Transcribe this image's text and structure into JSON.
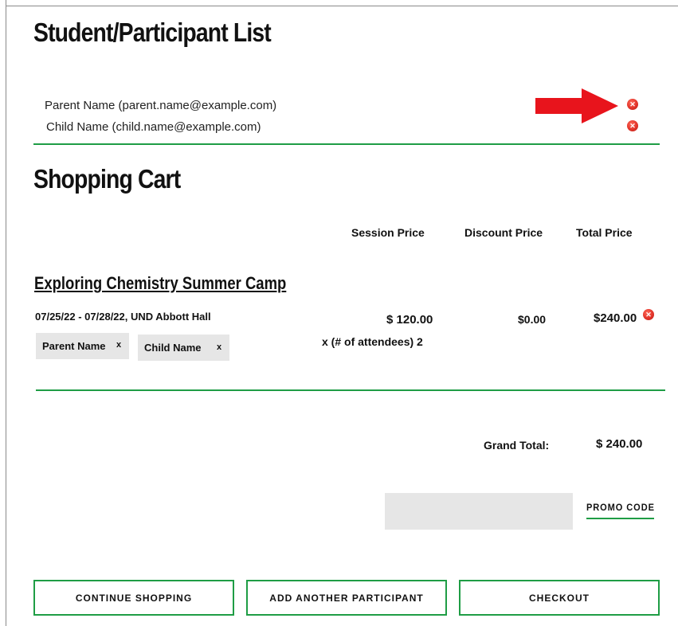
{
  "participants_section": {
    "title": "Student/Participant List",
    "participants": [
      {
        "label": "Parent Name (parent.name@example.com)"
      },
      {
        "label": "Child Name (child.name@example.com)"
      }
    ],
    "remove_icon": "remove-circle-icon",
    "annotation": "red-arrow-icon"
  },
  "cart": {
    "title": "Shopping Cart",
    "columns": {
      "session_price": "Session Price",
      "discount_price": "Discount Price",
      "total_price": "Total Price"
    },
    "items": [
      {
        "title": "Exploring Chemistry Summer Camp",
        "details": "07/25/22 - 07/28/22, UND Abbott Hall",
        "attendee_chips": [
          {
            "name": "Parent Name",
            "remove": "x"
          },
          {
            "name": "Child Name",
            "remove": "x"
          }
        ],
        "session_price": "$ 120.00",
        "attendees": "x  (# of attendees) 2",
        "discount_price": "$0.00",
        "total_price": "$240.00"
      }
    ],
    "grand_total_label": "Grand Total:",
    "grand_total_value": "$ 240.00",
    "promo": {
      "input_value": "",
      "button_label": "PROMO CODE"
    },
    "buttons": {
      "continue": "CONTINUE SHOPPING",
      "add_participant": "ADD ANOTHER PARTICIPANT",
      "checkout": "CHECKOUT"
    }
  },
  "colors": {
    "accent_green": "#1f9d45",
    "remove_red": "#e2342a",
    "input_gray": "#e6e6e6"
  }
}
